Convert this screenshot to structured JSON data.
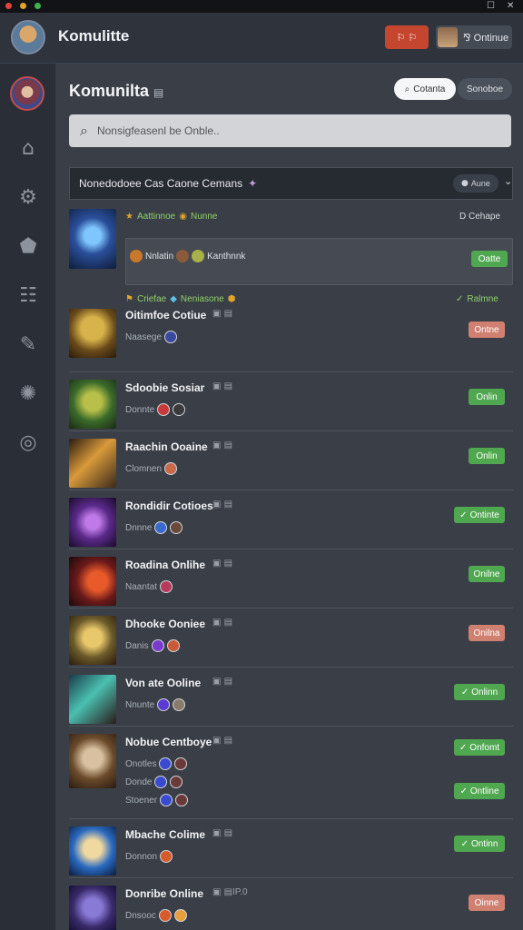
{
  "window": {
    "maximize_glyph": "☐",
    "close_glyph": "✕"
  },
  "header": {
    "title": "Komulitte",
    "red_button_label": "⚐ ⚐",
    "user_label": "⅋ Ontinue"
  },
  "main": {
    "title": "Komunilta",
    "title_glyph": "▤",
    "search_pill": "Cotanta",
    "filter_pill": "Sonoboe",
    "search_placeholder": "Nonsigfeasenl be Onble..",
    "section": {
      "title": "Nonedodoee Cas Caone Cemans",
      "status_label": "Aune"
    },
    "featured": {
      "tag1": "Aattinnoe",
      "tag2": "Nunne",
      "right_label": "D Cehape",
      "card_text1": "Nnlatin",
      "card_text2": "Kanthnnk",
      "card_button": "Oatte"
    },
    "second_header": {
      "tag1": "Criefae",
      "tag2": "Neniasone",
      "right_label": "Ralmne"
    },
    "rows": [
      {
        "name": "Oitimfoe Cotiue",
        "sub": "Naasege",
        "button": "Ontne",
        "button_style": "salmon",
        "check": false
      },
      {
        "name": "Sdoobie Sosiar",
        "sub": "Donnte",
        "button": "Onlin",
        "button_style": "green",
        "check": false
      },
      {
        "name": "Raachin Ooaine",
        "sub": "Clomnen",
        "button": "Onlin",
        "button_style": "green",
        "check": false
      },
      {
        "name": "Rondidir Cotioes",
        "sub": "Dnnne",
        "button": "Ontinte",
        "button_style": "green",
        "check": true
      },
      {
        "name": "Roadina Onlihe",
        "sub": "Naantat",
        "button": "Onilne",
        "button_style": "green",
        "check": false
      },
      {
        "name": "Dhooke Ooniee",
        "sub": "Danis",
        "button": "Onilna",
        "button_style": "salmon",
        "check": false
      },
      {
        "name": "Von ate Ooline",
        "sub": "Nnunte",
        "button": "Onlinn",
        "button_style": "green",
        "check": true
      },
      {
        "name": "Nobue Centboye",
        "sub": "Onotles",
        "sub2": "Donde",
        "sub3": "Stoener",
        "button": "Onfomt",
        "button2": "Ontline",
        "button_style": "green",
        "check": true
      },
      {
        "name": "Mbache Colime",
        "sub": "Donnon",
        "button": "Ontinn",
        "button_style": "green",
        "check": true
      },
      {
        "name": "Donribe Online",
        "sub": "Dnsooc",
        "button": "Oinne",
        "button_style": "salmon",
        "check": false,
        "extra": "IP.0"
      }
    ]
  },
  "colors": {
    "accent_green": "#4fa74f",
    "accent_salmon": "#d08070",
    "header_red": "#c4462f"
  }
}
